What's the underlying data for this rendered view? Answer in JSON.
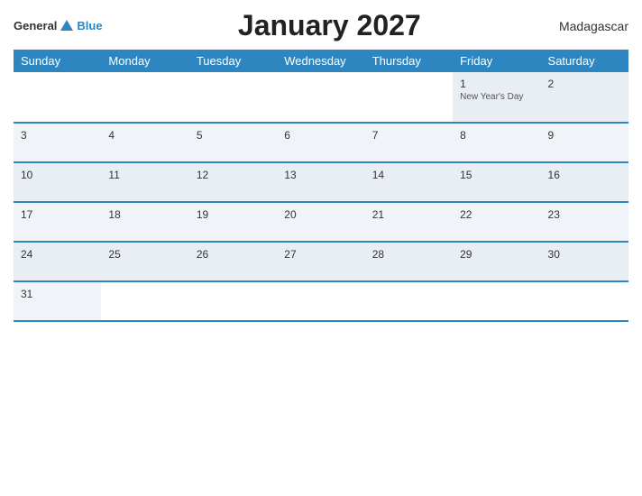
{
  "header": {
    "logo": {
      "general": "General",
      "blue": "Blue"
    },
    "title": "January 2027",
    "country": "Madagascar"
  },
  "weekdays": [
    "Sunday",
    "Monday",
    "Tuesday",
    "Wednesday",
    "Thursday",
    "Friday",
    "Saturday"
  ],
  "weeks": [
    [
      {
        "day": "",
        "empty": true
      },
      {
        "day": "",
        "empty": true
      },
      {
        "day": "",
        "empty": true
      },
      {
        "day": "",
        "empty": true
      },
      {
        "day": "",
        "empty": true
      },
      {
        "day": "1",
        "holiday": "New Year's Day"
      },
      {
        "day": "2"
      }
    ],
    [
      {
        "day": "3"
      },
      {
        "day": "4"
      },
      {
        "day": "5"
      },
      {
        "day": "6"
      },
      {
        "day": "7"
      },
      {
        "day": "8"
      },
      {
        "day": "9"
      }
    ],
    [
      {
        "day": "10"
      },
      {
        "day": "11"
      },
      {
        "day": "12"
      },
      {
        "day": "13"
      },
      {
        "day": "14"
      },
      {
        "day": "15"
      },
      {
        "day": "16"
      }
    ],
    [
      {
        "day": "17"
      },
      {
        "day": "18"
      },
      {
        "day": "19"
      },
      {
        "day": "20"
      },
      {
        "day": "21"
      },
      {
        "day": "22"
      },
      {
        "day": "23"
      }
    ],
    [
      {
        "day": "24"
      },
      {
        "day": "25"
      },
      {
        "day": "26"
      },
      {
        "day": "27"
      },
      {
        "day": "28"
      },
      {
        "day": "29"
      },
      {
        "day": "30"
      }
    ],
    [
      {
        "day": "31"
      },
      {
        "day": "",
        "empty": true
      },
      {
        "day": "",
        "empty": true
      },
      {
        "day": "",
        "empty": true
      },
      {
        "day": "",
        "empty": true
      },
      {
        "day": "",
        "empty": true
      },
      {
        "day": "",
        "empty": true
      }
    ]
  ],
  "colors": {
    "header_bg": "#2e86c1",
    "accent": "#2e86c1",
    "row_bg": "#f0f4f8"
  }
}
